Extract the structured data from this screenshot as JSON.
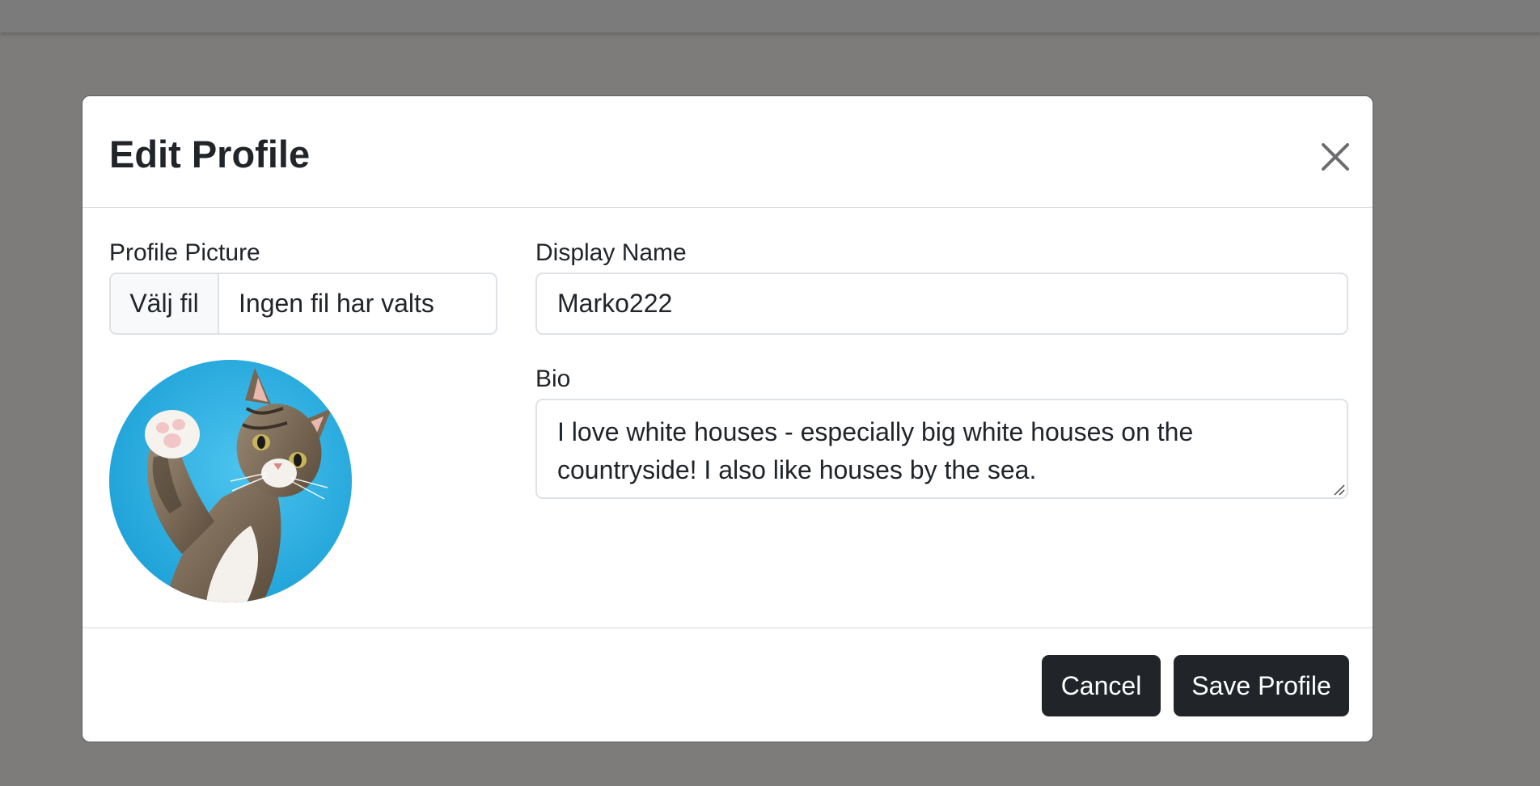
{
  "modal": {
    "title": "Edit Profile",
    "close_icon": "close-icon"
  },
  "profile_picture": {
    "label": "Profile Picture",
    "choose_file_label": "Välj fil",
    "file_status": "Ingen fil har valts",
    "avatar_description_icon": "cat-photo"
  },
  "display_name": {
    "label": "Display Name",
    "value": "Marko222"
  },
  "bio": {
    "label": "Bio",
    "value": "I love white houses - especially big white houses on the countryside! I also like houses by the sea."
  },
  "footer": {
    "cancel_label": "Cancel",
    "save_label": "Save Profile"
  },
  "colors": {
    "backdrop": "#7d7c7b",
    "modal_bg": "#ffffff",
    "button_dark": "#212529",
    "border": "#dee2e6",
    "avatar_bg": "#29aee4"
  }
}
